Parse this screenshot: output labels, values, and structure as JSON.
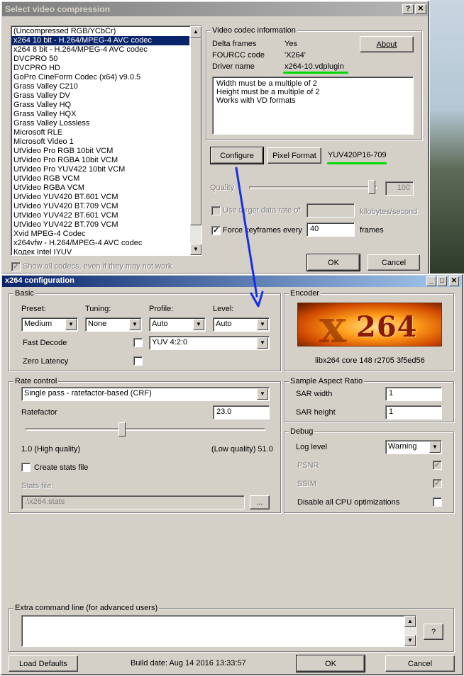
{
  "compress_dialog": {
    "title": "Select video compression",
    "codecs": [
      "(Uncompressed RGB/YCbCr)",
      "x264 10 bit - H.264/MPEG-4 AVC codec",
      "x264 8 bit - H.264/MPEG-4 AVC codec",
      "DVCPRO 50",
      "DVCPRO HD",
      "GoPro CineForm Codec (x64) v9.0.5",
      "Grass Valley C210",
      "Grass Valley DV",
      "Grass Valley HQ",
      "Grass Valley HQX",
      "Grass Valley Lossless",
      "Microsoft RLE",
      "Microsoft Video 1",
      "UtVideo Pro RGB 10bit VCM",
      "UtVideo Pro RGBA 10bit VCM",
      "UtVideo Pro YUV422 10bit VCM",
      "UtVideo RGB VCM",
      "UtVideo RGBA VCM",
      "UtVideo YUV420 BT.601 VCM",
      "UtVideo YUV420 BT.709 VCM",
      "UtVideo YUV422 BT.601 VCM",
      "UtVideo YUV422 BT.709 VCM",
      "Xvid MPEG-4 Codec",
      "x264vfw - H.264/MPEG-4 AVC codec",
      "Кодек Intel IYUV"
    ],
    "selected_index": 1,
    "info_group_label": "Video codec information",
    "delta_frames_label": "Delta frames",
    "delta_frames_value": "Yes",
    "fourcc_label": "FOURCC code",
    "fourcc_value": "'X264'",
    "driver_label": "Driver name",
    "driver_value": "x264-10.vdplugin",
    "about_label": "About",
    "notes": [
      "Width must be a multiple of 2",
      "Height must be a multiple of 2",
      "Works with VD formats"
    ],
    "configure_label": "Configure",
    "pixel_format_label": "Pixel Format",
    "pixel_format_value": "YUV420P16-709",
    "quality_label": "Quality",
    "quality_value": "100",
    "target_rate_label": "Use target data rate of",
    "kbps_label": "kilobytes/second",
    "keyframes_label": "Force keyframes every",
    "keyframes_value": "40",
    "frames_label": "frames",
    "show_all_label": "Show all codecs, even if they may not work",
    "ok_label": "OK",
    "cancel_label": "Cancel",
    "help_glyph": "?",
    "close_glyph": "✕"
  },
  "x264_dialog": {
    "title": "x264 configuration",
    "basic_label": "Basic",
    "preset_label": "Preset:",
    "preset_value": "Medium",
    "tuning_label": "Tuning:",
    "tuning_value": "None",
    "profile_label": "Profile:",
    "profile_value": "Auto",
    "level_label": "Level:",
    "level_value": "Auto",
    "fast_decode_label": "Fast Decode",
    "zero_latency_label": "Zero Latency",
    "colorspace_value": "YUV 4:2:0",
    "encoder_label": "Encoder",
    "logo_text": "264",
    "encoder_version": "libx264 core 148 r2705 3f5ed56",
    "rate_control_label": "Rate control",
    "rate_mode_value": "Single pass - ratefactor-based (CRF)",
    "ratefactor_label": "Ratefactor",
    "ratefactor_value": "23.0",
    "ratefactor_fraction": 0.4,
    "high_quality_label": "1.0 (High quality)",
    "low_quality_label": "(Low quality) 51.0",
    "create_stats_label": "Create stats file",
    "stats_file_label": "Stats file:",
    "stats_file_value": ".\\x264.stats",
    "browse_label": "...",
    "sar_label": "Sample Aspect Ratio",
    "sar_width_label": "SAR width",
    "sar_width_value": "1",
    "sar_height_label": "SAR height",
    "sar_height_value": "1",
    "debug_label": "Debug",
    "log_level_label": "Log level",
    "log_level_value": "Warning",
    "psnr_label": "PSNR",
    "ssim_label": "SSIM",
    "disable_cpu_label": "Disable all CPU optimizations",
    "extra_cmd_label": "Extra command line (for advanced users)",
    "help_label": "?",
    "load_defaults_label": "Load Defaults",
    "build_date": "Build date: Aug 14 2016 13:33:57",
    "ok_label": "OK",
    "cancel_label": "Cancel",
    "check_glyph": "✓",
    "arrow_glyph": "▼"
  },
  "colors": {
    "annotation_green": "#00d900",
    "annotation_blue": "#1a2ee6",
    "selection": "#0a246a"
  }
}
